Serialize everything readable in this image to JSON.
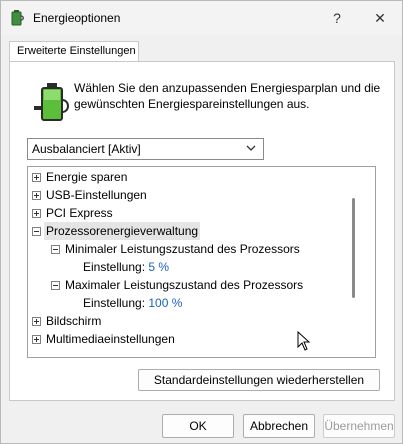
{
  "window": {
    "title": "Energieoptionen",
    "help_glyph": "?",
    "close_glyph": "✕"
  },
  "tab": {
    "label": "Erweiterte Einstellungen"
  },
  "description": "Wählen Sie den anzupassenden Energiesparplan und die gewünschten Energiespareinstellungen aus.",
  "plan_select": {
    "value": "Ausbalanciert [Aktiv]"
  },
  "tree": {
    "items": [
      {
        "label": "Energie sparen"
      },
      {
        "label": "USB-Einstellungen"
      },
      {
        "label": "PCI Express"
      },
      {
        "label": "Prozessorenergieverwaltung"
      },
      {
        "label": "Minimaler Leistungszustand des Prozessors"
      },
      {
        "label": "Einstellung:",
        "value": "5 %"
      },
      {
        "label": "Maximaler Leistungszustand des Prozessors"
      },
      {
        "label": "Einstellung:",
        "value": "100 %"
      },
      {
        "label": "Bildschirm"
      },
      {
        "label": "Multimediaeinstellungen"
      }
    ]
  },
  "buttons": {
    "restore": "Standardeinstellungen wiederherstellen",
    "ok": "OK",
    "cancel": "Abbrechen",
    "apply": "Übernehmen"
  },
  "colors": {
    "setting_value": "#1a62b8",
    "selected_bg": "#e5e5e5"
  }
}
